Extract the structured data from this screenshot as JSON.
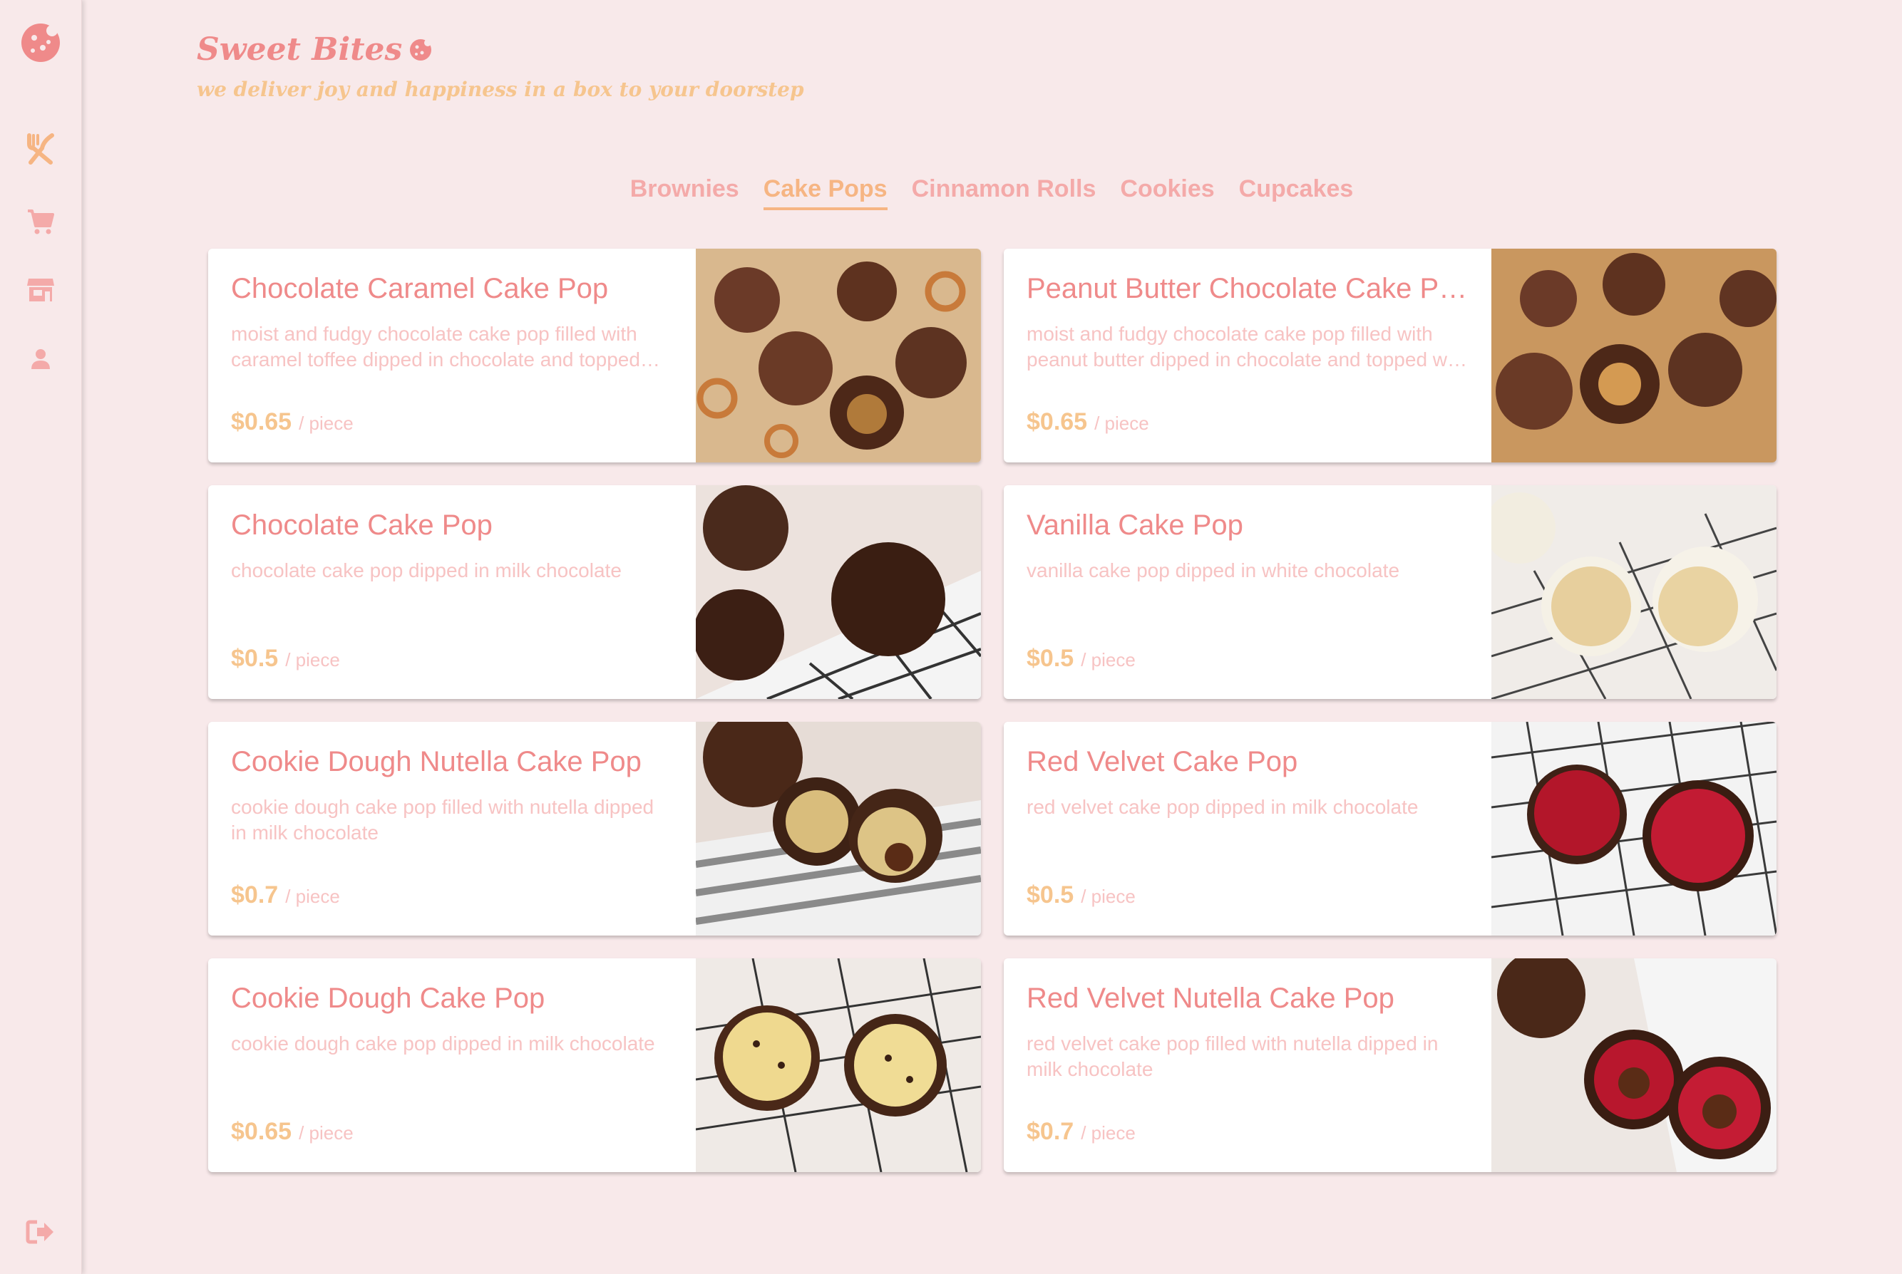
{
  "app": {
    "title": "Sweet Bites",
    "tagline": "we deliver joy and happiness in a box to your doorstep",
    "accent_pink": "#ef8a8a",
    "accent_peach": "#f6c58e",
    "background": "#f8e9ea"
  },
  "sidebar": {
    "logo_icon": "cookie-icon",
    "items": [
      {
        "icon": "utensils-icon",
        "active": true
      },
      {
        "icon": "cart-icon",
        "active": false
      },
      {
        "icon": "store-icon",
        "active": false
      },
      {
        "icon": "user-icon",
        "active": false
      }
    ],
    "logout_icon": "logout-icon"
  },
  "tabs": [
    {
      "label": "Brownies",
      "active": false
    },
    {
      "label": "Cake Pops",
      "active": true
    },
    {
      "label": "Cinnamon Rolls",
      "active": false
    },
    {
      "label": "Cookies",
      "active": false
    },
    {
      "label": "Cupcakes",
      "active": false
    }
  ],
  "products": [
    {
      "name": "Chocolate Caramel Cake Pop",
      "description": "moist and fudgy chocolate cake pop filled with caramel toffee dipped in chocolate and topped with pretzel pieces",
      "price": "$0.65",
      "unit": "/ piece",
      "image": "caramel-pretzel"
    },
    {
      "name": "Peanut Butter Chocolate Cake Pop",
      "description": "moist and fudgy chocolate cake pop filled with peanut butter dipped in chocolate and topped with peanut pieces",
      "price": "$0.65",
      "unit": "/ piece",
      "image": "peanut"
    },
    {
      "name": "Chocolate Cake Pop",
      "description": "chocolate cake pop dipped in milk chocolate",
      "price": "$0.5",
      "unit": "/ piece",
      "image": "chocolate"
    },
    {
      "name": "Vanilla Cake Pop",
      "description": "vanilla cake pop dipped in white chocolate",
      "price": "$0.5",
      "unit": "/ piece",
      "image": "vanilla"
    },
    {
      "name": "Cookie Dough Nutella Cake Pop",
      "description": "cookie dough cake pop filled with nutella dipped in milk chocolate",
      "price": "$0.7",
      "unit": "/ piece",
      "image": "cookie-nutella"
    },
    {
      "name": "Red Velvet Cake Pop",
      "description": "red velvet cake pop dipped in milk chocolate",
      "price": "$0.5",
      "unit": "/ piece",
      "image": "red-velvet"
    },
    {
      "name": "Cookie Dough Cake Pop",
      "description": "cookie dough cake pop dipped in milk chocolate",
      "price": "$0.65",
      "unit": "/ piece",
      "image": "cookie-dough"
    },
    {
      "name": "Red Velvet Nutella Cake Pop",
      "description": "red velvet cake pop filled with nutella dipped in milk chocolate",
      "price": "$0.7",
      "unit": "/ piece",
      "image": "red-velvet-nutella"
    }
  ]
}
